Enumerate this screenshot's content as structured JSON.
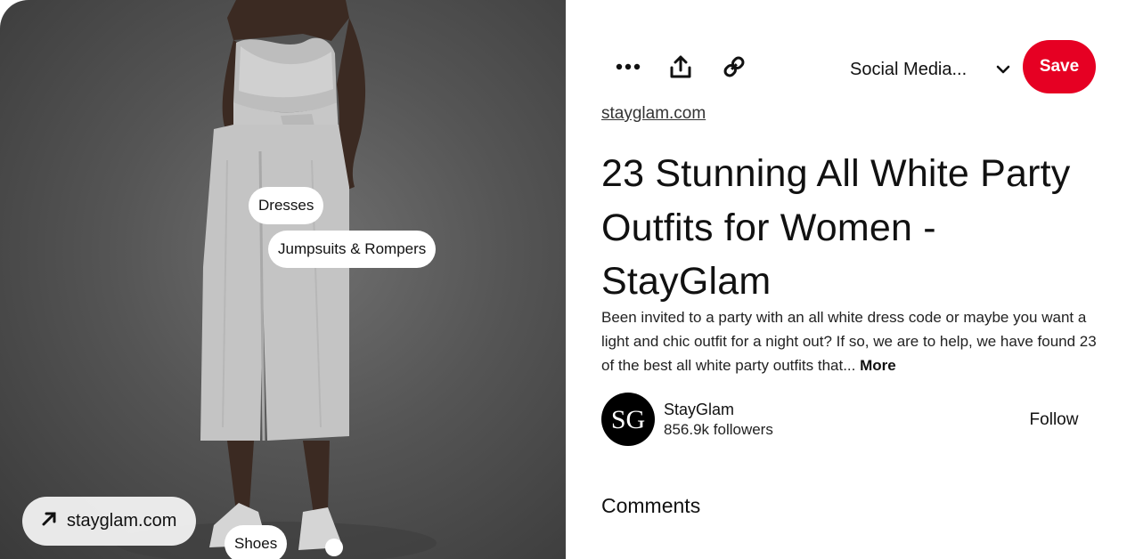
{
  "image_tags": {
    "dresses": "Dresses",
    "jumpsuits": "Jumpsuits & Rompers",
    "shoes": "Shoes"
  },
  "image_source_pill": {
    "label": "stayglam.com",
    "icon": "arrow-up-right-icon"
  },
  "toolbar": {
    "more_icon": "more-icon",
    "share_icon": "share-icon",
    "link_icon": "link-icon",
    "board_select": "Social Media...",
    "board_chevron_icon": "chevron-down-icon",
    "save_label": "Save",
    "save_color": "#e60023"
  },
  "pin": {
    "source_link": "stayglam.com",
    "title": "23 Stunning All White Party Outfits for Women - StayGlam",
    "description": "Been invited to a party with an all white dress code or maybe you want a light and chic outfit for a night out? If so, we are to help, we have found 23 of the best all white party outfits that...",
    "more_label": "More"
  },
  "creator": {
    "avatar_text": "SG",
    "name": "StayGlam",
    "followers": "856.9k followers",
    "follow_label": "Follow"
  },
  "comments": {
    "heading": "Comments"
  }
}
